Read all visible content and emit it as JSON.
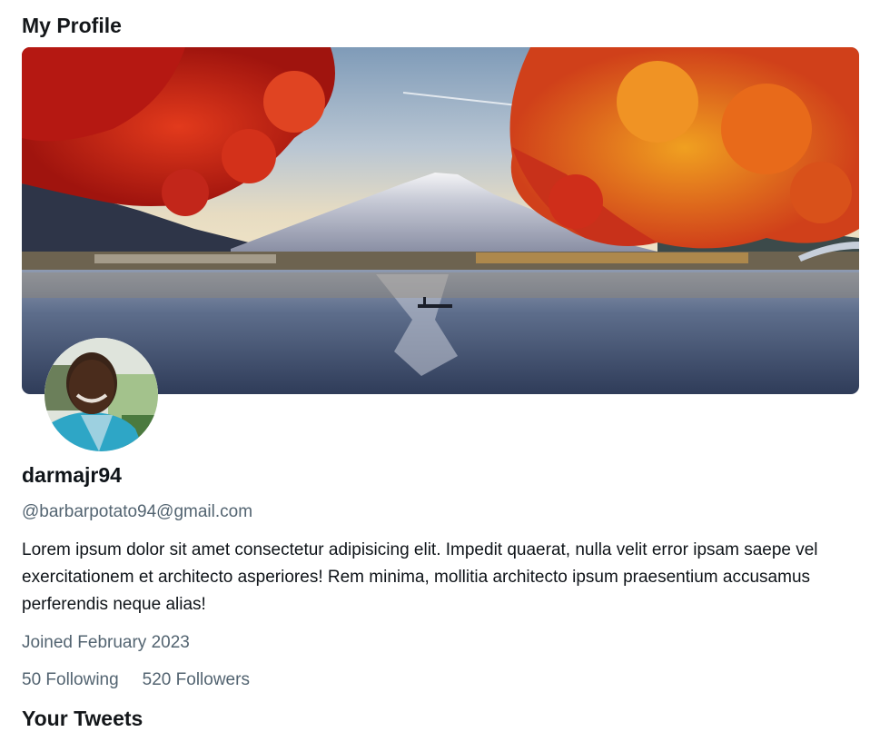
{
  "page": {
    "title": "My Profile"
  },
  "profile": {
    "username": "darmajr94",
    "handle": "@barbarpotato94@gmail.com",
    "bio": "Lorem ipsum dolor sit amet consectetur adipisicing elit. Impedit quaerat, nulla velit error ipsam saepe vel exercitationem et architecto asperiores! Rem minima, mollitia architecto ipsum praesentium accusamus perferendis neque alias!",
    "joined": "Joined February 2023",
    "following": "50 Following",
    "followers": "520 Followers"
  },
  "tweets": {
    "section_title": "Your Tweets"
  },
  "colors": {
    "primary_text": "#0f1419",
    "secondary_text": "#536471",
    "background": "#ffffff"
  }
}
